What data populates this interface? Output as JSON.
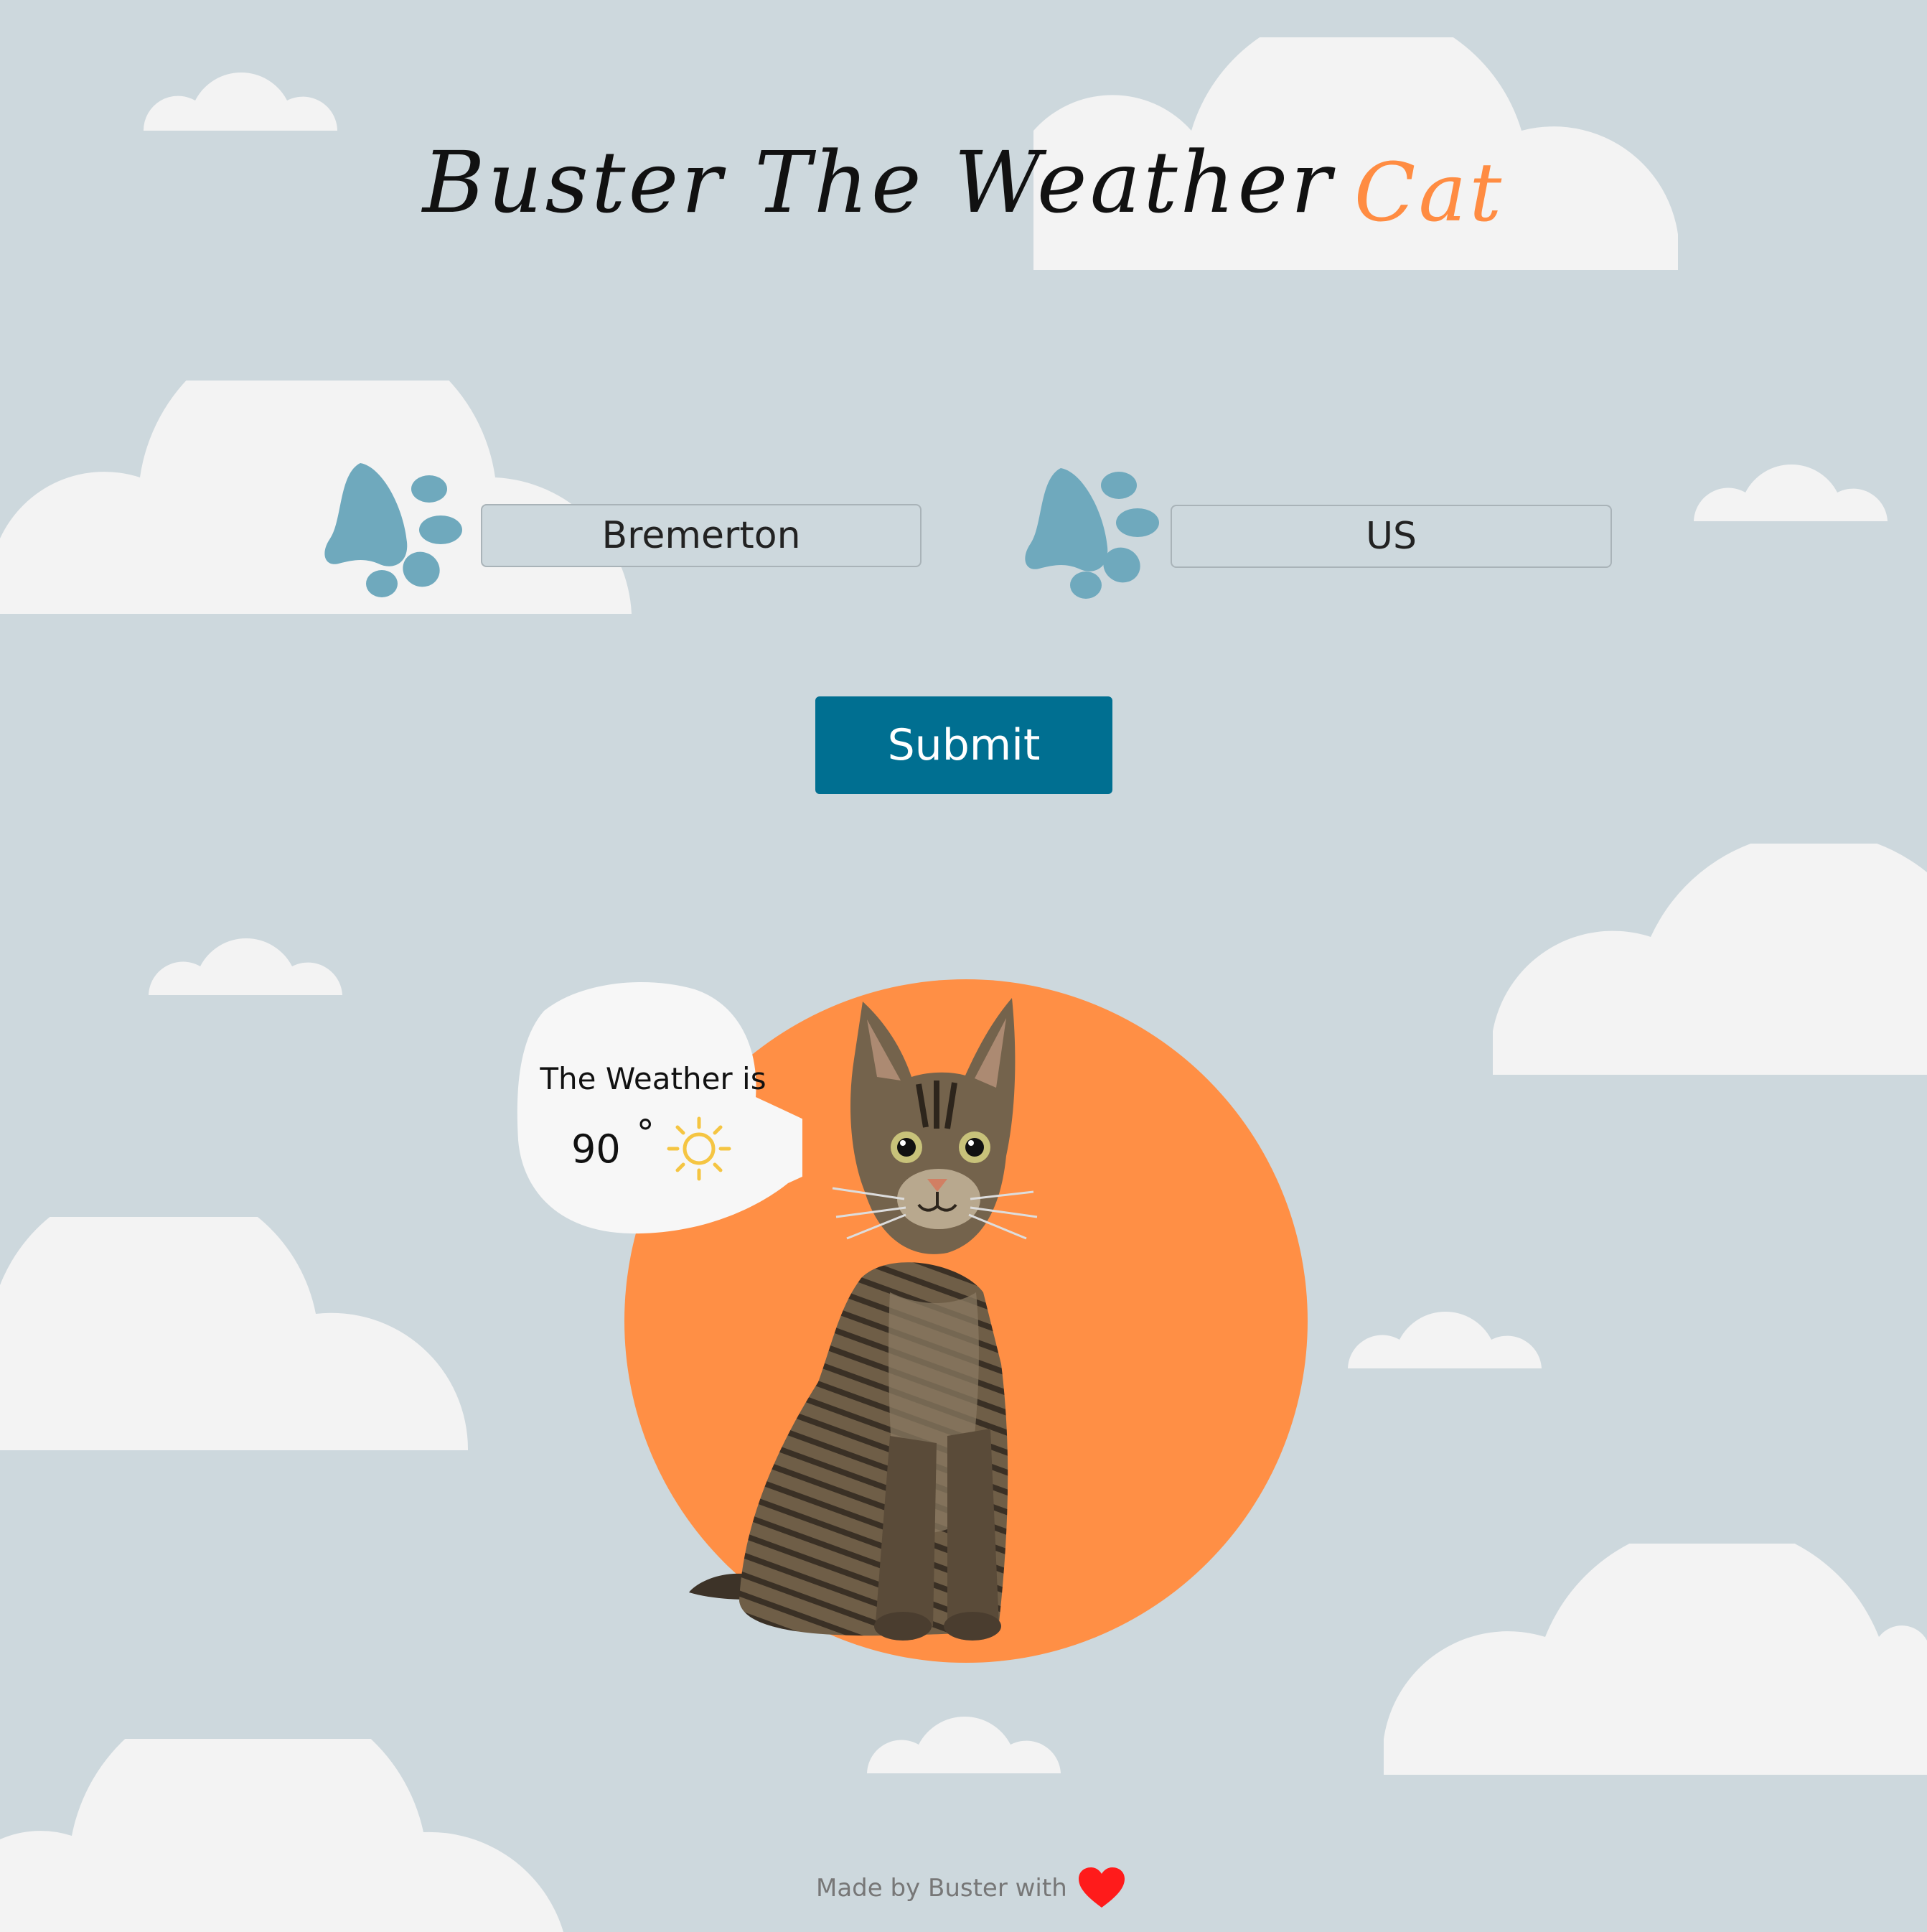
{
  "header": {
    "title_main": "Buster The Weather",
    "title_accent": "Cat"
  },
  "form": {
    "city_value": "Bremerton",
    "country_value": "US",
    "submit_label": "Submit"
  },
  "weather": {
    "caption": "The Weather is",
    "temperature": "90",
    "degree_symbol": "°",
    "condition_icon": "sun-icon"
  },
  "footer": {
    "text": "Made by Buster with",
    "heart_icon": "heart-icon"
  },
  "colors": {
    "background": "#cdd8dd",
    "cloud": "#f3f3f3",
    "accent_orange": "#ff8c42",
    "paw": "#6fa9bd",
    "button": "#006f91",
    "heart": "#ff1b1b",
    "sun": "#f5c542"
  }
}
